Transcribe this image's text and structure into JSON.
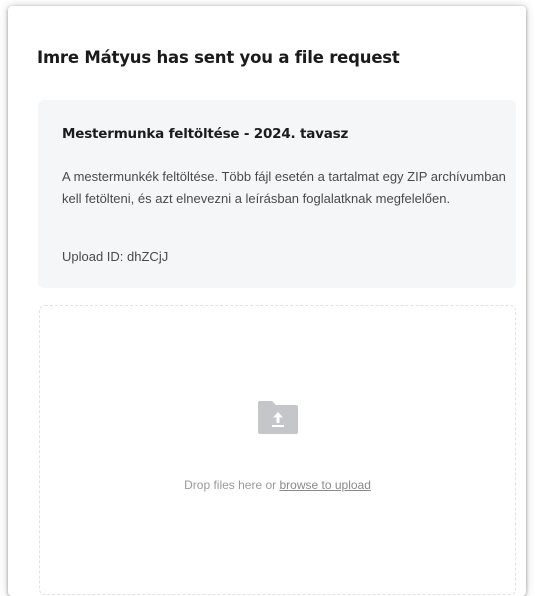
{
  "header": {
    "title": "Imre Mátyus has sent you a file request"
  },
  "request": {
    "title": "Mestermunka feltöltése - 2024. tavasz",
    "description": "A mestermunkék feltöltése. Több fájl esetén a tartalmat egy ZIP archívumban kell fetölteni, és azt elnevezni a leírásban foglalatknak megfelelően.",
    "upload_id": "Upload ID: dhZCjJ"
  },
  "dropzone": {
    "icon": "folder-upload-icon",
    "text": "Drop files here or ",
    "link": "browse to upload"
  },
  "colors": {
    "info_background": "#f5f6f8",
    "folder_icon": "#c4c6ca",
    "muted_text": "#9a9a9a"
  }
}
